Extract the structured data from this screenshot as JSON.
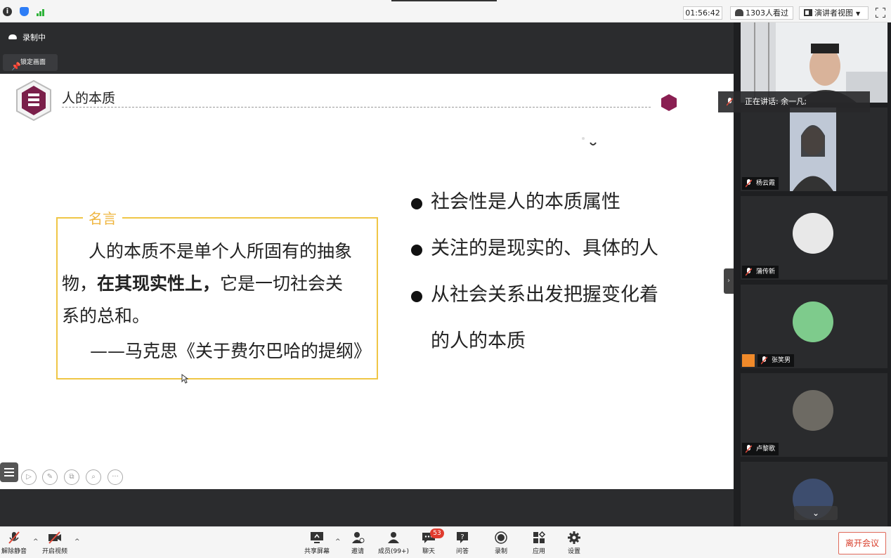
{
  "topbar": {
    "meeting_time": "01:56:42",
    "viewers": "1303人看过",
    "view_mode": "演讲者视图",
    "status_icons": [
      "info-icon",
      "shield-icon",
      "signal-icon"
    ]
  },
  "stage": {
    "recording_label": "录制中",
    "lock_label": "锁定画面"
  },
  "slide": {
    "title": "人的本质",
    "quote_tag": "名言",
    "quote_line1": "人的本质不是单个人所固有的抽象",
    "quote_line2_pre": "物，",
    "quote_line2_bold": "在其现实性上，",
    "quote_line2_post": "它是一切社会关",
    "quote_line3": "系的总和。",
    "quote_author": "——马克思《关于费尔巴哈的提纲》",
    "points": [
      "社会性是人的本质属性",
      "关注的是现实的、具体的人",
      "从社会关系出发把握变化着"
    ],
    "point_continuation": "的人的本质",
    "accent_color": "#efc646"
  },
  "speaking": {
    "label": "正在讲话: 余一凡;"
  },
  "participants": [
    {
      "name": "杨云霞"
    },
    {
      "name": "蒲传新"
    },
    {
      "name": "张笑男"
    },
    {
      "name": "卢黎歌"
    }
  ],
  "toolbar": {
    "unmute": "解除静音",
    "start_video": "开启视频",
    "share_screen": "共享屏幕",
    "invite": "邀请",
    "members": "成员(99+)",
    "chat": "聊天",
    "chat_badge": "53",
    "qa": "问答",
    "record": "录制",
    "apps": "应用",
    "settings": "设置",
    "leave": "离开会议"
  }
}
